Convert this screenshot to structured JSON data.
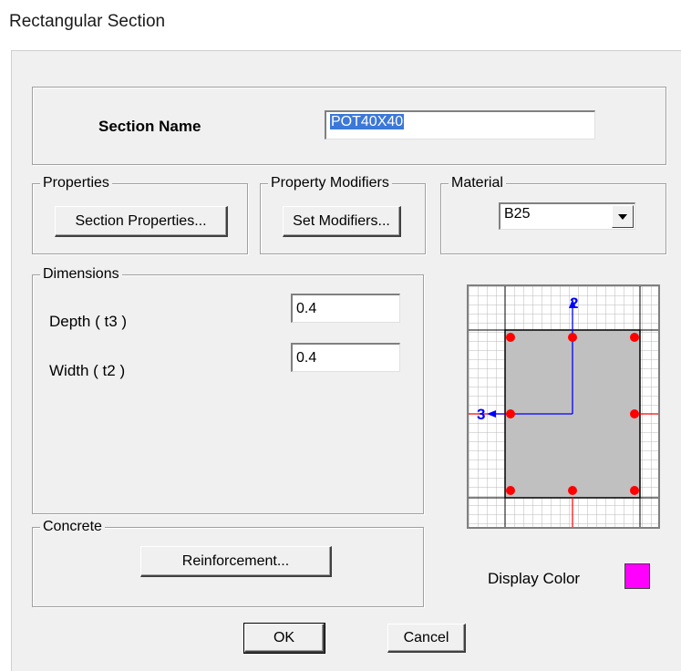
{
  "window": {
    "title": "Rectangular Section"
  },
  "section_name": {
    "label": "Section Name",
    "value": "POT40X40"
  },
  "properties": {
    "title": "Properties",
    "button_label": "Section Properties..."
  },
  "property_modifiers": {
    "title": "Property Modifiers",
    "button_label": "Set Modifiers..."
  },
  "material": {
    "title": "Material",
    "selected": "B25"
  },
  "dimensions": {
    "title": "Dimensions",
    "depth_label": "Depth  ( t3 )",
    "depth_value": "0.4",
    "width_label": "Width  ( t2 )",
    "width_value": "0.4"
  },
  "concrete": {
    "title": "Concrete",
    "button_label": "Reinforcement..."
  },
  "display_color": {
    "label": "Display Color",
    "color": "#ff00ff"
  },
  "preview": {
    "axis_vertical_label": "2",
    "axis_horizontal_label": "3",
    "rebar_count": 8
  },
  "footer": {
    "ok_label": "OK",
    "cancel_label": "Cancel"
  },
  "colors": {
    "selection": "#3b78d8",
    "rebar": "#ff0000",
    "axis": "#0000ff",
    "section_fill": "#c0c0c0"
  }
}
